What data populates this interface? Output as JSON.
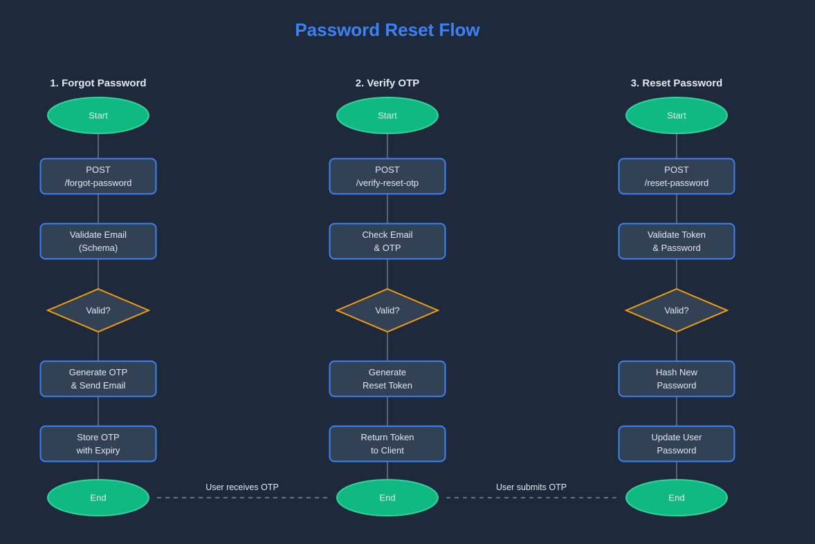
{
  "title": "Password Reset Flow",
  "colors": {
    "background": "#1e293b",
    "title": "#3b82f6",
    "column_title": "#e2e8f0",
    "terminal_fill": "#10b981",
    "terminal_stroke": "#34d399",
    "process_fill": "#334155",
    "process_stroke": "#3b82f6",
    "decision_fill": "#334155",
    "decision_stroke": "#f59e0b",
    "text": "#e2e8f0",
    "connector": "#64748b",
    "dashed": "#64748b"
  },
  "columns": [
    {
      "heading": "1. Forgot Password",
      "nodes": [
        {
          "type": "terminal",
          "lines": [
            "Start"
          ]
        },
        {
          "type": "process",
          "lines": [
            "POST",
            "/forgot-password"
          ]
        },
        {
          "type": "process",
          "lines": [
            "Validate Email",
            "(Schema)"
          ]
        },
        {
          "type": "decision",
          "lines": [
            "Valid?"
          ]
        },
        {
          "type": "process",
          "lines": [
            "Generate OTP",
            "& Send Email"
          ]
        },
        {
          "type": "process",
          "lines": [
            "Store OTP",
            "with Expiry"
          ]
        },
        {
          "type": "terminal",
          "lines": [
            "End"
          ]
        }
      ]
    },
    {
      "heading": "2. Verify OTP",
      "nodes": [
        {
          "type": "terminal",
          "lines": [
            "Start"
          ]
        },
        {
          "type": "process",
          "lines": [
            "POST",
            "/verify-reset-otp"
          ]
        },
        {
          "type": "process",
          "lines": [
            "Check Email",
            "& OTP"
          ]
        },
        {
          "type": "decision",
          "lines": [
            "Valid?"
          ]
        },
        {
          "type": "process",
          "lines": [
            "Generate",
            "Reset Token"
          ]
        },
        {
          "type": "process",
          "lines": [
            "Return Token",
            "to Client"
          ]
        },
        {
          "type": "terminal",
          "lines": [
            "End"
          ]
        }
      ]
    },
    {
      "heading": "3. Reset Password",
      "nodes": [
        {
          "type": "terminal",
          "lines": [
            "Start"
          ]
        },
        {
          "type": "process",
          "lines": [
            "POST",
            "/reset-password"
          ]
        },
        {
          "type": "process",
          "lines": [
            "Validate Token",
            "& Password"
          ]
        },
        {
          "type": "decision",
          "lines": [
            "Valid?"
          ]
        },
        {
          "type": "process",
          "lines": [
            "Hash New",
            "Password"
          ]
        },
        {
          "type": "process",
          "lines": [
            "Update User",
            "Password"
          ]
        },
        {
          "type": "terminal",
          "lines": [
            "End"
          ]
        }
      ]
    }
  ],
  "links": [
    {
      "from": 0,
      "to": 1,
      "label": "User receives OTP"
    },
    {
      "from": 1,
      "to": 2,
      "label": "User submits OTP"
    }
  ]
}
